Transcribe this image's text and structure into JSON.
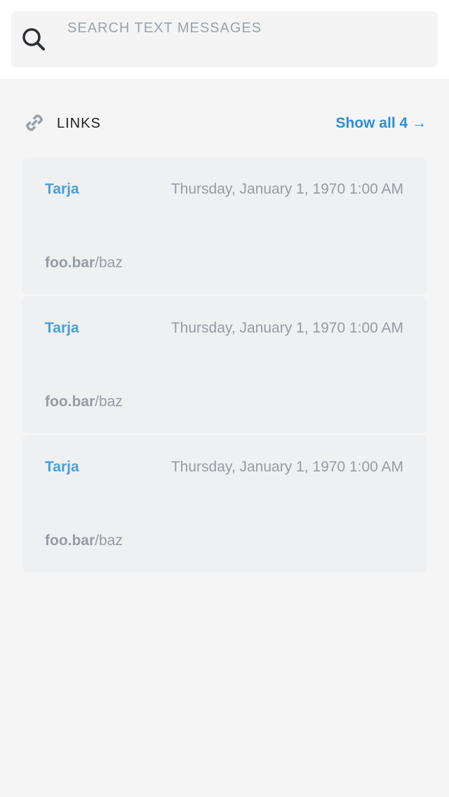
{
  "search": {
    "placeholder": "SEARCH TEXT MESSAGES",
    "icon": "search-icon"
  },
  "links_section": {
    "title": "LINKS",
    "icon": "link-icon",
    "show_all_label": "Show all 4 →"
  },
  "links": [
    {
      "sender": "Tarja",
      "date": "Thursday, January 1, 1970 1:00 AM",
      "domain": "foo.bar",
      "path": "/baz"
    },
    {
      "sender": "Tarja",
      "date": "Thursday, January 1, 1970 1:00 AM",
      "domain": "foo.bar",
      "path": "/baz"
    },
    {
      "sender": "Tarja",
      "date": "Thursday, January 1, 1970 1:00 AM",
      "domain": "foo.bar",
      "path": "/baz"
    }
  ],
  "colors": {
    "accent": "#2d8fd5",
    "sender": "#4a9fd8",
    "muted_text": "#959ca3",
    "card_bg": "#eff0f2",
    "page_bg": "#f5f5f5"
  }
}
